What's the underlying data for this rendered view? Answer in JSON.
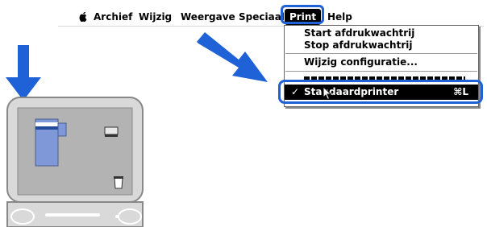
{
  "menubar": {
    "items": [
      "Archief",
      "Wijzig",
      "Weergave",
      "Speciaal"
    ],
    "print": "Print",
    "help": "Help"
  },
  "dropdown": {
    "items": [
      "Start afdrukwachtrij",
      "Stop afdrukwachtrij",
      "Wijzig configuratie..."
    ],
    "selected": {
      "check": "✓",
      "label": "Standaardprinter",
      "shortcut": "⌘L"
    }
  },
  "colors": {
    "highlight_ring": "#1f61d6",
    "arrow": "#1f61d6",
    "computer_body": "#d9d9d9"
  }
}
